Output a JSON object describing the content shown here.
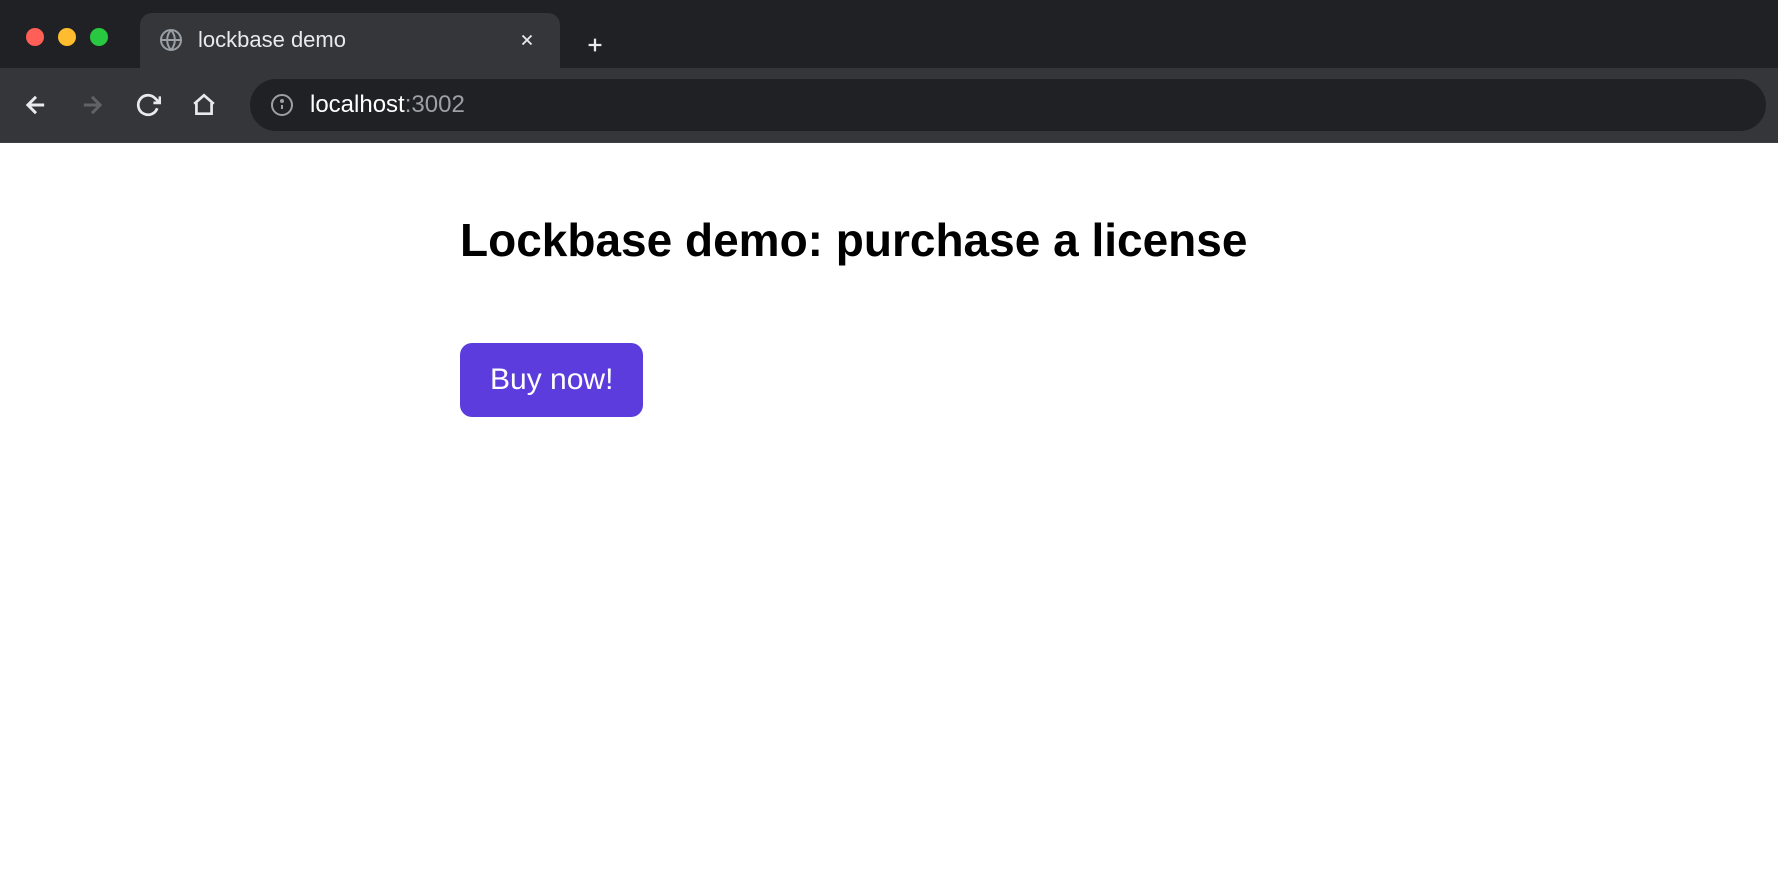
{
  "browser": {
    "tab_title": "lockbase demo",
    "url_host": "localhost",
    "url_port": ":3002"
  },
  "page": {
    "heading": "Lockbase demo: purchase a license",
    "buy_button_label": "Buy now!"
  },
  "colors": {
    "accent": "#5d3cde"
  }
}
